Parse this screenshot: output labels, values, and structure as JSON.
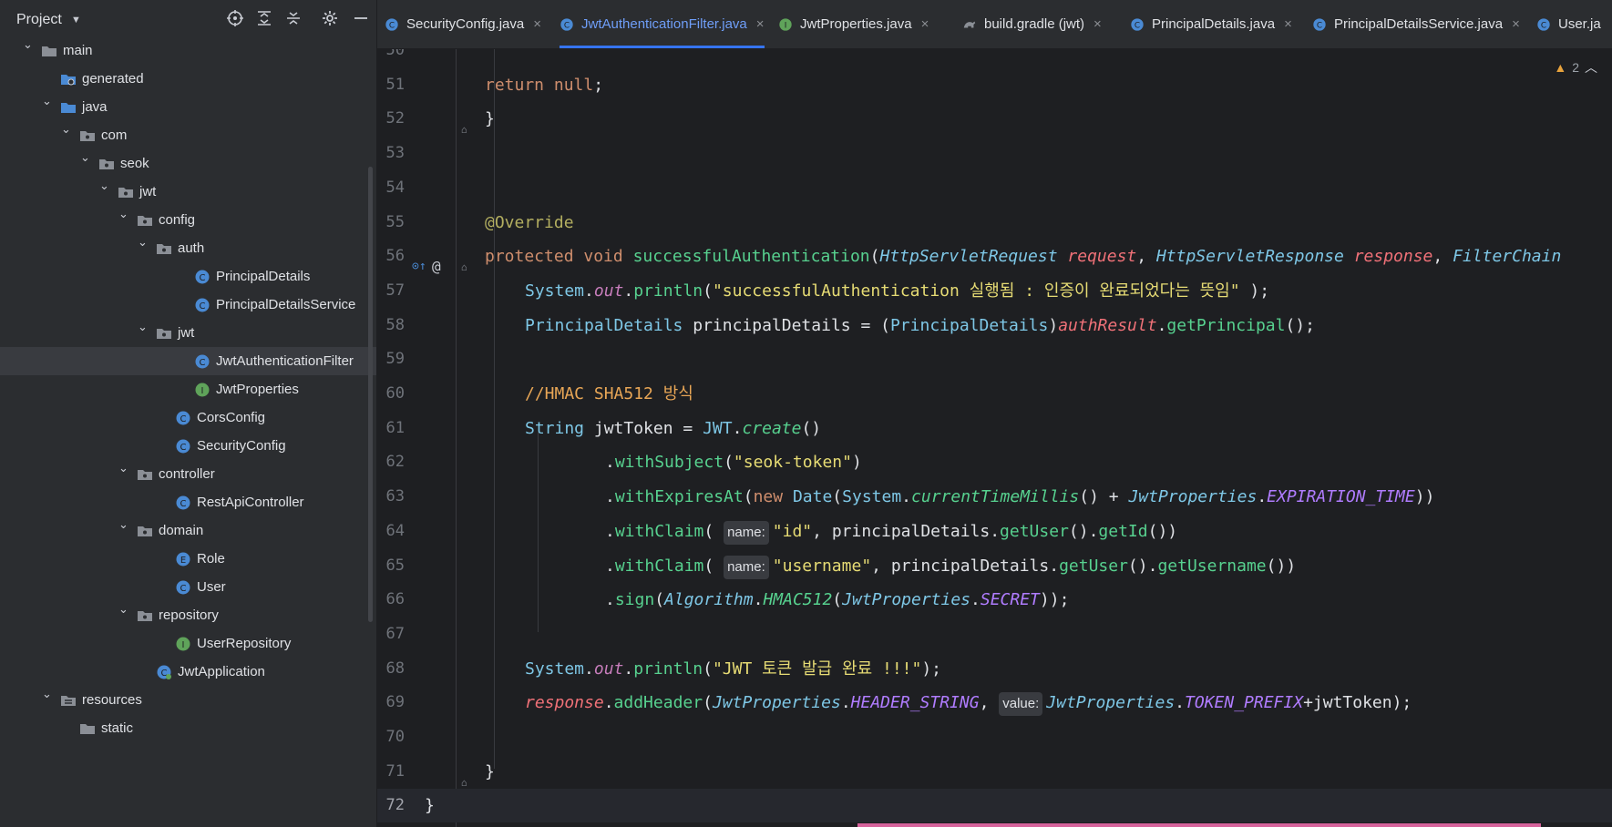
{
  "project_panel": {
    "title": "Project",
    "icons": [
      "locate-icon",
      "expand-all-icon",
      "collapse-all-icon",
      "gear-icon",
      "minimize-icon"
    ]
  },
  "tree": [
    {
      "label": "main",
      "type": "folder",
      "depth": 1,
      "expanded": true
    },
    {
      "label": "generated",
      "type": "gen-folder",
      "depth": 2,
      "expanded": null
    },
    {
      "label": "java",
      "type": "source-folder",
      "depth": 2,
      "expanded": true
    },
    {
      "label": "com",
      "type": "package",
      "depth": 3,
      "expanded": true
    },
    {
      "label": "seok",
      "type": "package",
      "depth": 4,
      "expanded": true
    },
    {
      "label": "jwt",
      "type": "package",
      "depth": 5,
      "expanded": true
    },
    {
      "label": "config",
      "type": "package",
      "depth": 6,
      "expanded": true
    },
    {
      "label": "auth",
      "type": "package",
      "depth": 7,
      "expanded": true
    },
    {
      "label": "PrincipalDetails",
      "type": "class",
      "depth": 9,
      "expanded": null
    },
    {
      "label": "PrincipalDetailsService",
      "type": "class",
      "depth": 9,
      "expanded": null
    },
    {
      "label": "jwt",
      "type": "package",
      "depth": 7,
      "expanded": true
    },
    {
      "label": "JwtAuthenticationFilter",
      "type": "class",
      "depth": 9,
      "expanded": null,
      "selected": true
    },
    {
      "label": "JwtProperties",
      "type": "interface",
      "depth": 9,
      "expanded": null
    },
    {
      "label": "CorsConfig",
      "type": "class",
      "depth": 8,
      "expanded": null
    },
    {
      "label": "SecurityConfig",
      "type": "class",
      "depth": 8,
      "expanded": null
    },
    {
      "label": "controller",
      "type": "package",
      "depth": 6,
      "expanded": true
    },
    {
      "label": "RestApiController",
      "type": "class",
      "depth": 8,
      "expanded": null
    },
    {
      "label": "domain",
      "type": "package",
      "depth": 6,
      "expanded": true
    },
    {
      "label": "Role",
      "type": "enum",
      "depth": 8,
      "expanded": null
    },
    {
      "label": "User",
      "type": "class",
      "depth": 8,
      "expanded": null
    },
    {
      "label": "repository",
      "type": "package",
      "depth": 6,
      "expanded": true
    },
    {
      "label": "UserRepository",
      "type": "interface",
      "depth": 8,
      "expanded": null
    },
    {
      "label": "JwtApplication",
      "type": "app",
      "depth": 7,
      "expanded": null
    },
    {
      "label": "resources",
      "type": "resources",
      "depth": 2,
      "expanded": true
    },
    {
      "label": "static",
      "type": "folder",
      "depth": 3,
      "expanded": null
    }
  ],
  "tabs": [
    {
      "label": "SecurityConfig.java",
      "icon": "class",
      "active": false
    },
    {
      "label": "JwtAuthenticationFilter.java",
      "icon": "class",
      "active": true
    },
    {
      "label": "JwtProperties.java",
      "icon": "interface",
      "active": false
    },
    {
      "label": "build.gradle (jwt)",
      "icon": "gradle",
      "active": false
    },
    {
      "label": "PrincipalDetails.java",
      "icon": "class",
      "active": false
    },
    {
      "label": "PrincipalDetailsService.java",
      "icon": "class",
      "active": false
    },
    {
      "label": "User.ja",
      "icon": "class",
      "active": false
    }
  ],
  "warnings": {
    "count": "2"
  },
  "code_lines": [
    {
      "num": "50",
      "tokens": []
    },
    {
      "num": "51",
      "tokens": [
        [
          "kw",
          "return "
        ],
        [
          "kw",
          "null"
        ],
        [
          "def",
          ";"
        ]
      ]
    },
    {
      "num": "52",
      "tokens": [
        [
          "def",
          "}"
        ]
      ]
    },
    {
      "num": "53",
      "tokens": []
    },
    {
      "num": "54",
      "tokens": []
    },
    {
      "num": "55",
      "tokens": [
        [
          "ann",
          "@Override"
        ]
      ]
    },
    {
      "num": "56",
      "tokens": [
        [
          "kw",
          "protected "
        ],
        [
          "kw",
          "void "
        ],
        [
          "mth",
          "successfulAuthentication"
        ],
        [
          "def",
          "("
        ],
        [
          "cls it",
          "HttpServletRequest "
        ],
        [
          "par",
          "request"
        ],
        [
          "def",
          ", "
        ],
        [
          "cls it",
          "HttpServletResponse "
        ],
        [
          "par",
          "response"
        ],
        [
          "def",
          ", "
        ],
        [
          "cls it",
          "FilterChain"
        ]
      ]
    },
    {
      "num": "57",
      "tokens": [
        [
          "cls",
          "System"
        ],
        [
          "def",
          "."
        ],
        [
          "st",
          "out"
        ],
        [
          "def",
          "."
        ],
        [
          "mth",
          "println"
        ],
        [
          "def",
          "("
        ],
        [
          "str",
          "\"successfulAuthentication 실행됨 : 인증이 완료되었다는 뜻임\""
        ],
        [
          "def",
          " );"
        ]
      ]
    },
    {
      "num": "58",
      "tokens": [
        [
          "cls",
          "PrincipalDetails"
        ],
        [
          "def",
          " principalDetails = ("
        ],
        [
          "cls",
          "PrincipalDetails"
        ],
        [
          "def",
          ")"
        ],
        [
          "par",
          "authResult"
        ],
        [
          "def",
          "."
        ],
        [
          "mth",
          "getPrincipal"
        ],
        [
          "def",
          "();"
        ]
      ]
    },
    {
      "num": "59",
      "tokens": []
    },
    {
      "num": "60",
      "tokens": [
        [
          "cm",
          "//HMAC SHA512 방식"
        ]
      ]
    },
    {
      "num": "61",
      "tokens": [
        [
          "cls",
          "String"
        ],
        [
          "def",
          " jwtToken = "
        ],
        [
          "cls",
          "JWT"
        ],
        [
          "def",
          "."
        ],
        [
          "mth it",
          "create"
        ],
        [
          "def",
          "()"
        ]
      ]
    },
    {
      "num": "62",
      "tokens": [
        [
          "def",
          "."
        ],
        [
          "mth",
          "withSubject"
        ],
        [
          "def",
          "("
        ],
        [
          "str",
          "\"seok-token\""
        ],
        [
          "def",
          ")"
        ]
      ]
    },
    {
      "num": "63",
      "tokens": [
        [
          "def",
          "."
        ],
        [
          "mth",
          "withExpiresAt"
        ],
        [
          "def",
          "("
        ],
        [
          "kw",
          "new "
        ],
        [
          "cls",
          "Date"
        ],
        [
          "def",
          "("
        ],
        [
          "cls",
          "System"
        ],
        [
          "def",
          "."
        ],
        [
          "mth it",
          "currentTimeMillis"
        ],
        [
          "def",
          "() + "
        ],
        [
          "cls it",
          "JwtProperties"
        ],
        [
          "def",
          "."
        ],
        [
          "ivar",
          "EXPIRATION_TIME"
        ],
        [
          "def",
          "))"
        ]
      ]
    },
    {
      "num": "64",
      "tokens": [
        [
          "def",
          "."
        ],
        [
          "mth",
          "withClaim"
        ],
        [
          "def",
          "( "
        ],
        [
          "hint",
          "name:"
        ],
        [
          "str",
          "\"id\""
        ],
        [
          "def",
          ", principalDetails."
        ],
        [
          "mth",
          "getUser"
        ],
        [
          "def",
          "()."
        ],
        [
          "mth",
          "getId"
        ],
        [
          "def",
          "())"
        ]
      ]
    },
    {
      "num": "65",
      "tokens": [
        [
          "def",
          "."
        ],
        [
          "mth",
          "withClaim"
        ],
        [
          "def",
          "( "
        ],
        [
          "hint",
          "name:"
        ],
        [
          "str",
          "\"username\""
        ],
        [
          "def",
          ", principalDetails."
        ],
        [
          "mth",
          "getUser"
        ],
        [
          "def",
          "()."
        ],
        [
          "mth",
          "getUsername"
        ],
        [
          "def",
          "())"
        ]
      ]
    },
    {
      "num": "66",
      "tokens": [
        [
          "def",
          "."
        ],
        [
          "mth",
          "sign"
        ],
        [
          "def",
          "("
        ],
        [
          "cls it",
          "Algorithm"
        ],
        [
          "def",
          "."
        ],
        [
          "mth it",
          "HMAC512"
        ],
        [
          "def",
          "("
        ],
        [
          "cls it",
          "JwtProperties"
        ],
        [
          "def",
          "."
        ],
        [
          "ivar",
          "SECRET"
        ],
        [
          "def",
          "));"
        ]
      ]
    },
    {
      "num": "67",
      "tokens": []
    },
    {
      "num": "68",
      "tokens": [
        [
          "cls",
          "System"
        ],
        [
          "def",
          "."
        ],
        [
          "st",
          "out"
        ],
        [
          "def",
          "."
        ],
        [
          "mth",
          "println"
        ],
        [
          "def",
          "("
        ],
        [
          "str",
          "\"JWT 토큰 발급 완료 !!!\""
        ],
        [
          "def",
          ");"
        ]
      ]
    },
    {
      "num": "69",
      "tokens": [
        [
          "par",
          "response"
        ],
        [
          "def",
          "."
        ],
        [
          "mth",
          "addHeader"
        ],
        [
          "def",
          "("
        ],
        [
          "cls it",
          "JwtProperties"
        ],
        [
          "def",
          "."
        ],
        [
          "ivar",
          "HEADER_STRING"
        ],
        [
          "def",
          ", "
        ],
        [
          "hint",
          "value:"
        ],
        [
          "cls it",
          "JwtProperties"
        ],
        [
          "def",
          "."
        ],
        [
          "ivar",
          "TOKEN_PREFIX"
        ],
        [
          "def",
          "+jwtToken);"
        ]
      ]
    },
    {
      "num": "70",
      "tokens": []
    },
    {
      "num": "71",
      "tokens": [
        [
          "def",
          "}"
        ]
      ]
    },
    {
      "num": "72",
      "tokens": [
        [
          "def",
          "}"
        ]
      ]
    }
  ]
}
